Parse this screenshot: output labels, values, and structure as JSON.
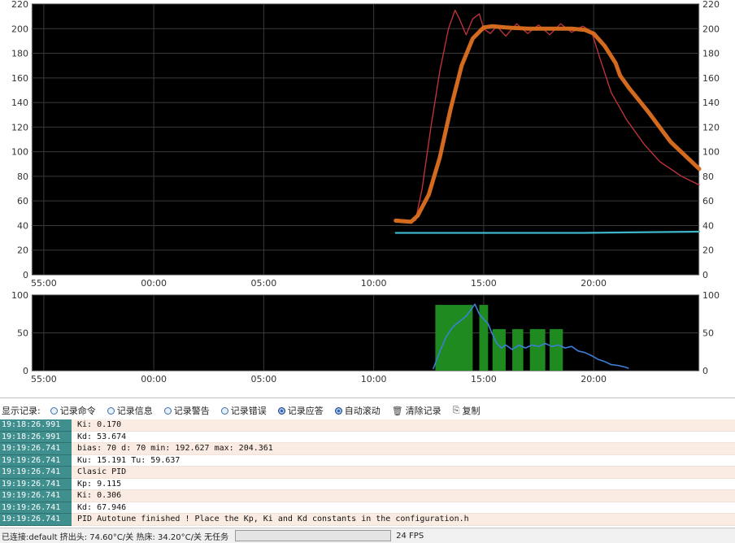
{
  "upper_chart": {
    "y_ticks_left": [
      "220",
      "200",
      "180",
      "160",
      "140",
      "120",
      "100",
      "80",
      "60",
      "40",
      "20",
      "0"
    ],
    "y_ticks_right": [
      "220",
      "200",
      "180",
      "160",
      "140",
      "120",
      "100",
      "80",
      "60",
      "40",
      "20",
      "0"
    ],
    "x_ticks": [
      "55:00",
      "00:00",
      "05:00",
      "10:00",
      "15:00",
      "20:00"
    ]
  },
  "lower_chart": {
    "y_ticks_left": [
      "100",
      "50",
      "0"
    ],
    "y_ticks_right": [
      "100",
      "50",
      "0"
    ],
    "x_ticks": [
      "55:00",
      "00:00",
      "05:00",
      "10:00",
      "15:00",
      "20:00"
    ]
  },
  "chart_data": [
    {
      "type": "line",
      "ylim": [
        0,
        220
      ],
      "xlim": [
        "54:40",
        "24:50"
      ],
      "grid": true,
      "series": [
        {
          "color": "#c8343c",
          "x": [
            11.0,
            11.9,
            12.2,
            12.6,
            13.0,
            13.4,
            13.7,
            13.9,
            14.2,
            14.5,
            14.8,
            15.0,
            15.3,
            15.6,
            16.0,
            16.5,
            17.0,
            17.5,
            18.0,
            18.5,
            19.0,
            19.5,
            19.9,
            20.3,
            20.8,
            21.5,
            22.3,
            23.0,
            24.0,
            24.8
          ],
          "y": [
            45,
            44,
            70,
            120,
            165,
            200,
            215,
            208,
            195,
            208,
            212,
            200,
            196,
            202,
            194,
            204,
            196,
            203,
            195,
            204,
            197,
            202,
            198,
            175,
            148,
            126,
            106,
            92,
            80,
            73
          ]
        },
        {
          "color": "#d46a1e",
          "x": [
            11.0,
            11.7,
            12.0,
            12.5,
            13.0,
            13.5,
            14.0,
            14.5,
            15.0,
            15.4,
            16.0,
            17.0,
            18.0,
            19.0,
            19.6,
            20.0,
            20.5,
            21.0,
            21.2,
            21.6,
            22.5,
            23.5,
            24.8
          ],
          "y": [
            44,
            43,
            48,
            65,
            95,
            135,
            170,
            192,
            201,
            202,
            201,
            200,
            200,
            200,
            199,
            196,
            186,
            172,
            162,
            152,
            132,
            108,
            86
          ]
        },
        {
          "color": "#3fb5c9",
          "x": [
            11.0,
            19.5,
            24.8
          ],
          "y": [
            34,
            34,
            35
          ]
        }
      ]
    },
    {
      "type": "area",
      "ylim": [
        0,
        100
      ],
      "grid": true,
      "bars": [
        {
          "x0": 12.8,
          "x1": 14.5,
          "value": 87
        },
        {
          "x0": 14.8,
          "x1": 15.2,
          "value": 87
        },
        {
          "x0": 15.4,
          "x1": 16.0,
          "value": 55
        },
        {
          "x0": 16.3,
          "x1": 16.8,
          "value": 55
        },
        {
          "x0": 17.1,
          "x1": 17.8,
          "value": 55
        },
        {
          "x0": 18.0,
          "x1": 18.6,
          "value": 55
        }
      ],
      "bar_color": "#1f8a1f",
      "series": [
        {
          "color": "#3d7fd8",
          "x": [
            12.7,
            13.0,
            13.3,
            13.6,
            13.9,
            14.2,
            14.4,
            14.6,
            14.8,
            15.0,
            15.2,
            15.4,
            15.6,
            15.8,
            16.0,
            16.3,
            16.6,
            16.9,
            17.2,
            17.5,
            17.8,
            18.1,
            18.4,
            18.7,
            19.0,
            19.3,
            19.6,
            19.9,
            20.2,
            20.5,
            20.8,
            21.1,
            21.4,
            21.6
          ],
          "y": [
            2,
            25,
            45,
            58,
            65,
            72,
            80,
            88,
            75,
            68,
            62,
            48,
            36,
            30,
            34,
            28,
            34,
            30,
            34,
            32,
            36,
            32,
            34,
            30,
            32,
            26,
            24,
            20,
            15,
            12,
            8,
            7,
            5,
            3
          ]
        }
      ]
    }
  ],
  "controls": {
    "display_label": "显示记录:",
    "items": [
      {
        "label": "记录命令",
        "on": false
      },
      {
        "label": "记录信息",
        "on": false
      },
      {
        "label": "记录警告",
        "on": false
      },
      {
        "label": "记录错误",
        "on": false
      },
      {
        "label": "记录应答",
        "on": true
      },
      {
        "label": "自动滚动",
        "on": true
      }
    ],
    "clear_label": "清除记录",
    "copy_label": "复制",
    "clear_icon": "trash-icon",
    "copy_icon": "copy-icon"
  },
  "log": [
    {
      "time": "19:18:26.991",
      "msg": "Ki: 0.170"
    },
    {
      "time": "19:18:26.991",
      "msg": "Kd: 53.674"
    },
    {
      "time": "19:19:26.741",
      "msg": "bias: 70 d: 70 min: 192.627 max: 204.361"
    },
    {
      "time": "19:19:26.741",
      "msg": "Ku: 15.191 Tu: 59.637"
    },
    {
      "time": "19:19:26.741",
      "msg": "Clasic PID"
    },
    {
      "time": "19:19:26.741",
      "msg": "Kp: 9.115"
    },
    {
      "time": "19:19:26.741",
      "msg": "Ki: 0.306"
    },
    {
      "time": "19:19:26.741",
      "msg": "Kd: 67.946"
    },
    {
      "time": "19:19:26.741",
      "msg": "PID Autotune finished ! Place the Kp, Ki and Kd constants in the configuration.h"
    }
  ],
  "status": {
    "text": "已连接:default  挤出头: 74.60°C/关 热床: 34.20°C/关    无任务",
    "fps": "24 FPS"
  }
}
